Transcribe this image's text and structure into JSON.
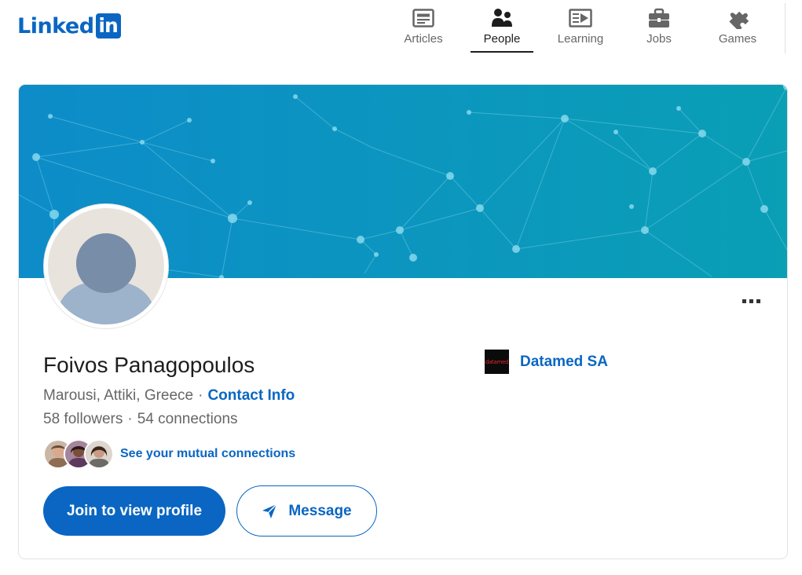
{
  "brand": {
    "logo_text": "Linked",
    "logo_box": "in",
    "color": "#0a66c2"
  },
  "nav": {
    "items": [
      {
        "label": "Articles",
        "icon": "articles-icon",
        "active": false
      },
      {
        "label": "People",
        "icon": "people-icon",
        "active": true
      },
      {
        "label": "Learning",
        "icon": "learning-icon",
        "active": false
      },
      {
        "label": "Jobs",
        "icon": "briefcase-icon",
        "active": false
      },
      {
        "label": "Games",
        "icon": "puzzle-icon",
        "active": false
      }
    ]
  },
  "profile": {
    "name": "Foivos Panagopoulos",
    "location": "Marousi, Attiki, Greece",
    "contact_info_label": "Contact Info",
    "followers": "58 followers",
    "connections": "54 connections",
    "mutual_label": "See your mutual connections",
    "join_button": "Join to view profile",
    "message_button": "Message",
    "separator": "·"
  },
  "company": {
    "name": "Datamed SA",
    "logo_text": "datamed"
  },
  "colors": {
    "accent": "#0a66c2",
    "banner_start": "#0c92c9",
    "banner_end": "#0aa0b3",
    "text_secondary": "#666666"
  }
}
